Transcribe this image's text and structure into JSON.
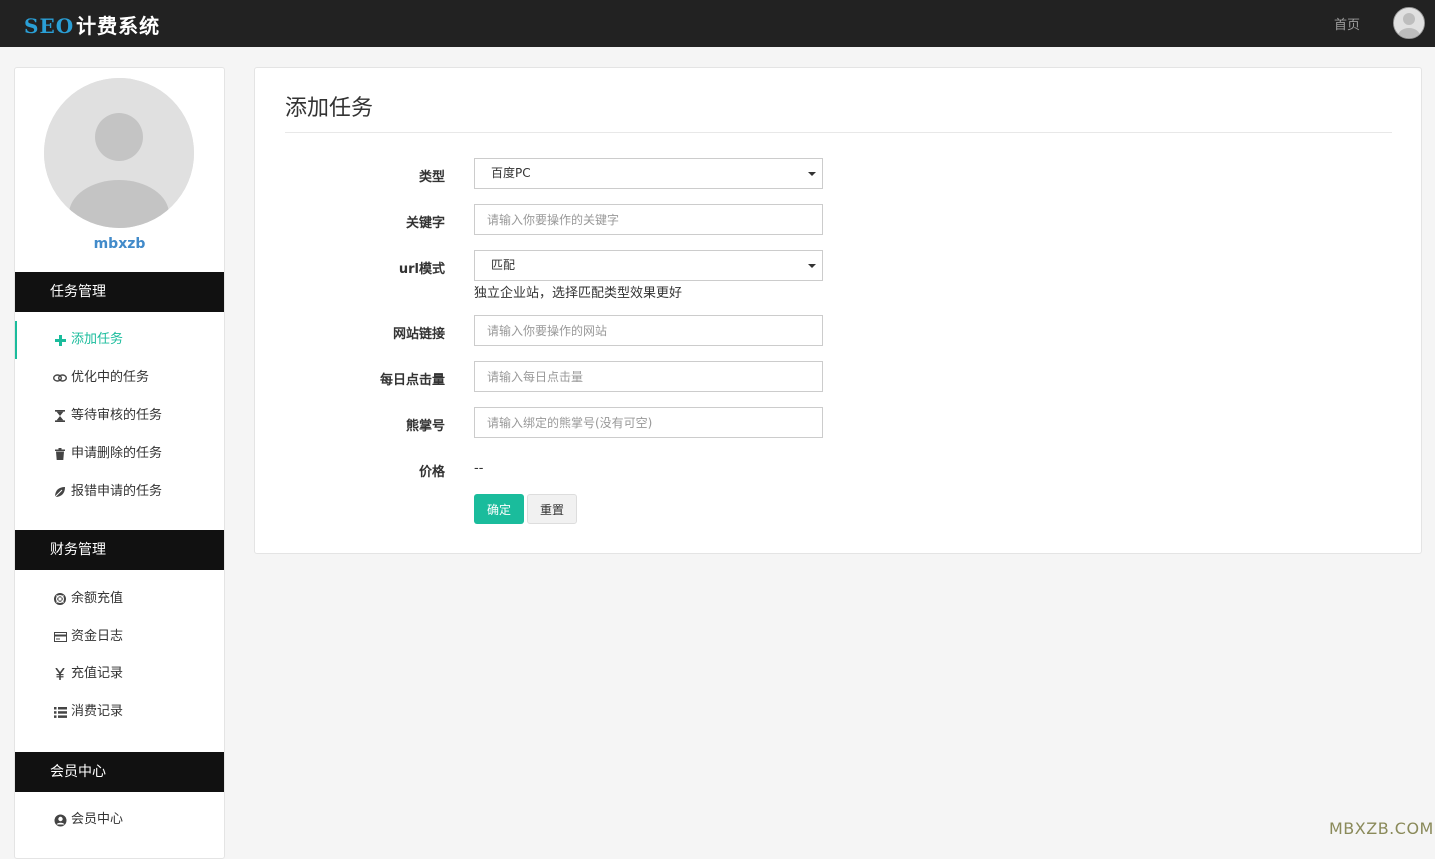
{
  "header": {
    "logo_seo": "SEO",
    "logo_rest": "计费系统",
    "home_link": "首页"
  },
  "sidebar": {
    "username": "mbxzb",
    "sections": [
      {
        "title": "任务管理",
        "items": [
          {
            "label": "添加任务",
            "icon": "plus-icon",
            "active": true
          },
          {
            "label": "优化中的任务",
            "icon": "link-icon"
          },
          {
            "label": "等待审核的任务",
            "icon": "hourglass-icon"
          },
          {
            "label": "申请删除的任务",
            "icon": "trash-icon"
          },
          {
            "label": "报错申请的任务",
            "icon": "leaf-icon"
          }
        ]
      },
      {
        "title": "财务管理",
        "items": [
          {
            "label": "余额充值",
            "icon": "lifebuoy-icon"
          },
          {
            "label": "资金日志",
            "icon": "credit-card-icon"
          },
          {
            "label": "充值记录",
            "icon": "yen-icon"
          },
          {
            "label": "消费记录",
            "icon": "list-icon"
          }
        ]
      },
      {
        "title": "会员中心",
        "items": [
          {
            "label": "会员中心",
            "icon": "user-circle-icon"
          }
        ]
      }
    ]
  },
  "main": {
    "title": "添加任务",
    "form": {
      "type_label": "类型",
      "type_value": "百度PC",
      "keyword_label": "关键字",
      "keyword_placeholder": "请输入你要操作的关键字",
      "url_mode_label": "url模式",
      "url_mode_value": "匹配",
      "url_mode_help": "独立企业站，选择匹配类型效果更好",
      "site_label": "网站链接",
      "site_placeholder": "请输入你要操作的网站",
      "clicks_label": "每日点击量",
      "clicks_placeholder": "请输入每日点击量",
      "bear_label": "熊掌号",
      "bear_placeholder": "请输入绑定的熊掌号(没有可空)",
      "price_label": "价格",
      "price_value": "--",
      "submit_label": "确定",
      "reset_label": "重置"
    }
  },
  "watermark": "MBXZB.COM",
  "colors": {
    "accent": "#1abc9c",
    "topbar": "#222222",
    "section_header": "#111111",
    "logo_blue": "#2a9fd6",
    "username_link": "#428bca"
  }
}
